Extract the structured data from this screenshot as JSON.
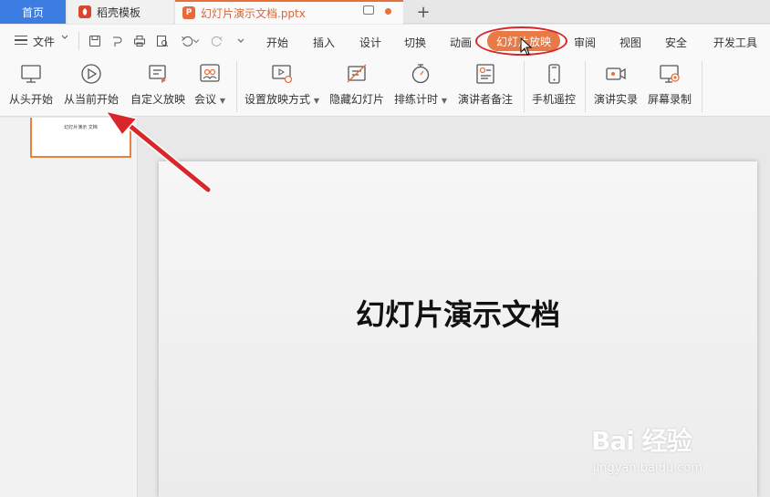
{
  "tabs": {
    "home": "首页",
    "daoke": "稻壳模板",
    "doc": "幻灯片演示文档.pptx",
    "logo_p": "P",
    "plus": "+"
  },
  "menu": {
    "file": "文件",
    "items": [
      "开始",
      "插入",
      "设计",
      "切换",
      "动画",
      "幻灯片放映",
      "审阅",
      "视图",
      "安全",
      "开发工具"
    ]
  },
  "ribbon": {
    "from_start": "从头开始",
    "from_current": "从当前开始",
    "custom_show": "自定义放映",
    "meeting": "会议",
    "setup_show": "设置放映方式",
    "hide_slide": "隐藏幻灯片",
    "rehearse": "排练计时",
    "presenter_notes": "演讲者备注",
    "phone_remote": "手机遥控",
    "record_talk": "演讲实录",
    "screen_record": "屏幕录制"
  },
  "thumbnail": {
    "title": "幻灯片演示 文档"
  },
  "slide": {
    "title": "幻灯片演示文档"
  },
  "watermark": {
    "main": "Bai 经验",
    "sub": "jingyan.baidu.com"
  },
  "colors": {
    "accent": "#e87a45",
    "home_tab": "#3b7de1",
    "annotation": "#d8262a"
  }
}
